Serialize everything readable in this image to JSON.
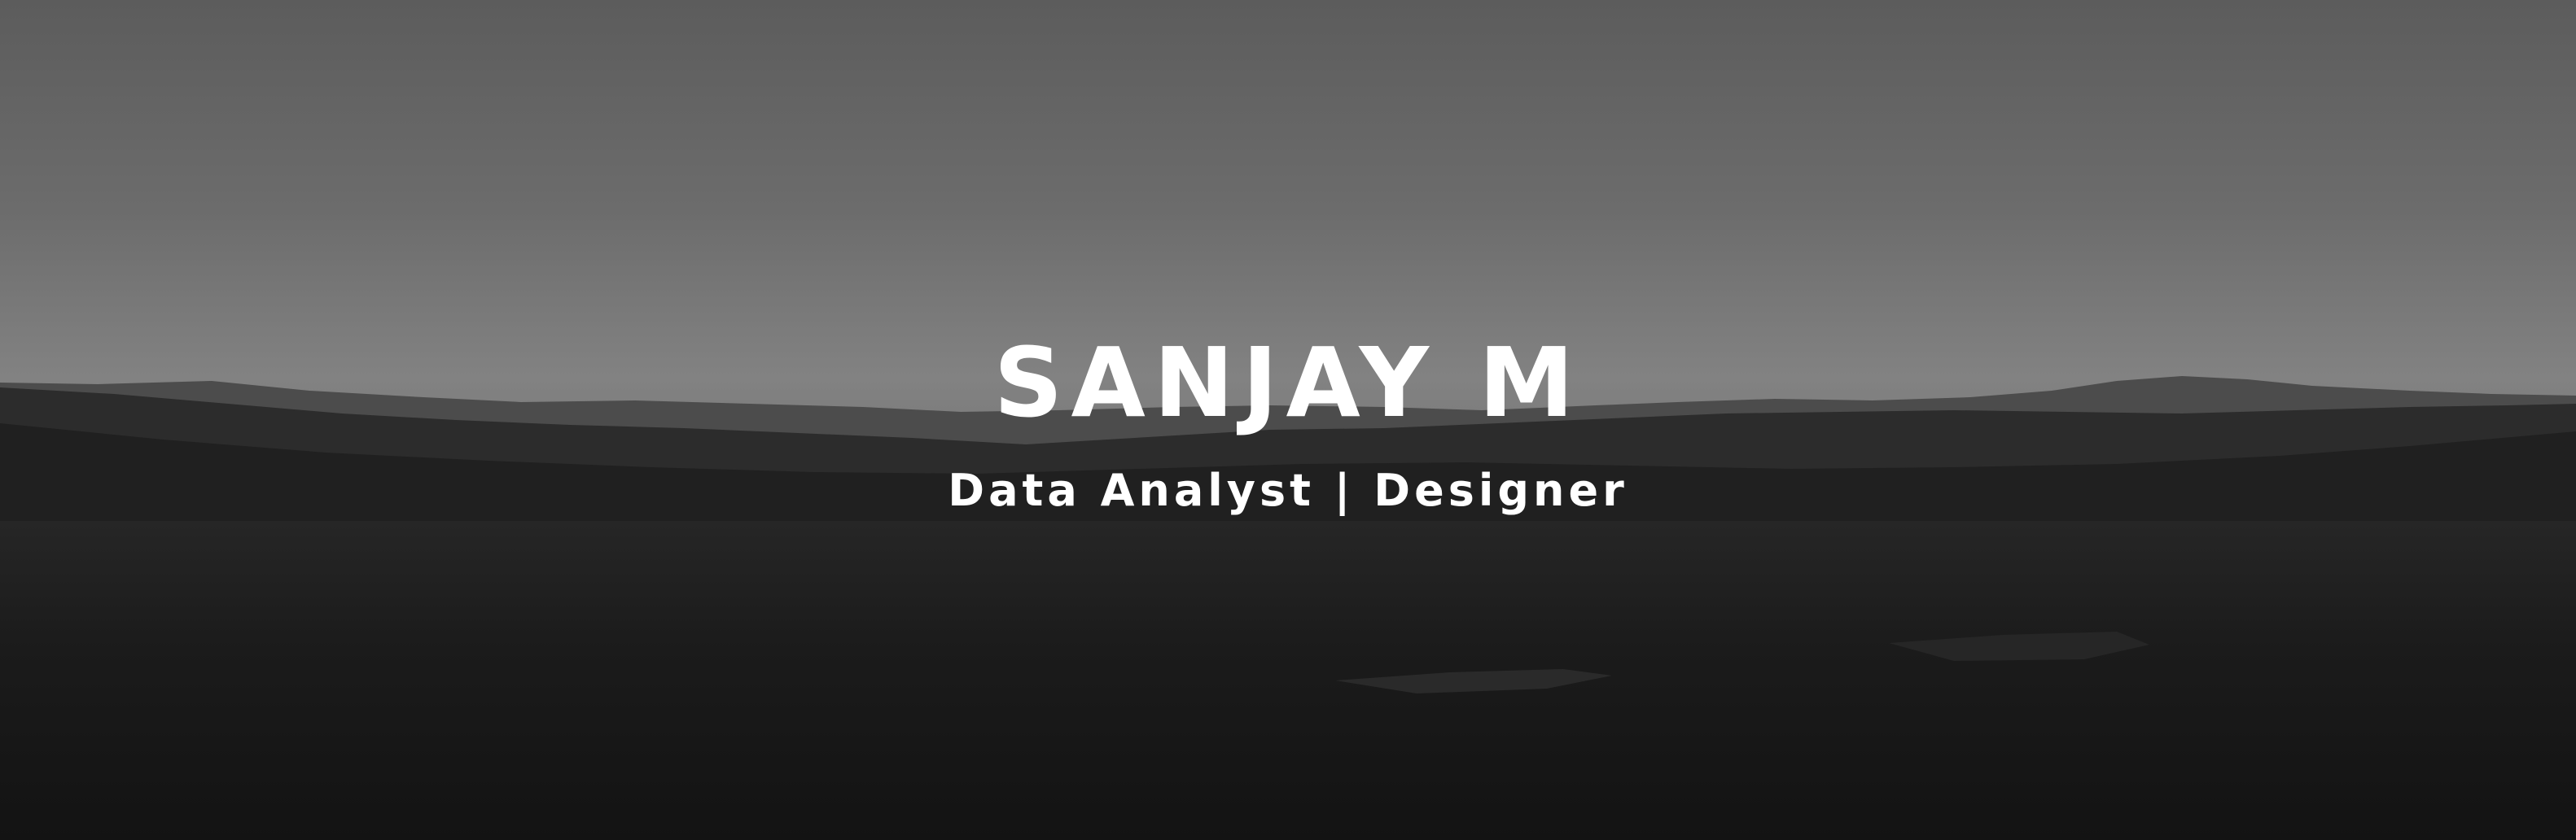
{
  "banner": {
    "name": "SANJAY M",
    "tagline": "Data Analyst | Designer"
  },
  "colors": {
    "sky_top": "#5e5e5e",
    "sky_horizon": "#808080",
    "far_hills": "#4a4a4a",
    "mid_hills": "#2a2a2a",
    "foreground": "#141414",
    "text": "#ffffff"
  }
}
